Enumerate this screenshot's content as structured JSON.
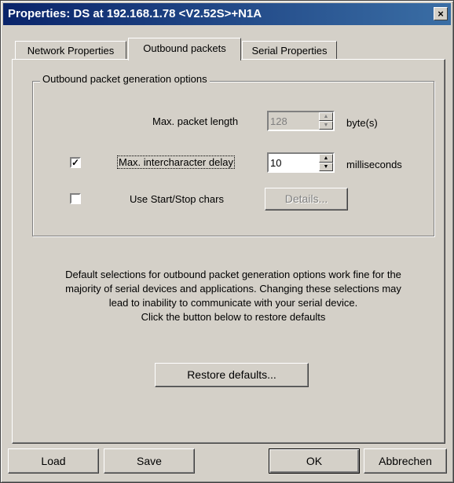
{
  "window": {
    "title": "Properties: DS at 192.168.1.78 <V2.52S>+N1A",
    "close_glyph": "×",
    "close_icon": "close-icon"
  },
  "tabs": [
    {
      "label": "Network Properties",
      "active": false
    },
    {
      "label": "Outbound packets",
      "active": true
    },
    {
      "label": "Serial Properties",
      "active": false
    }
  ],
  "group": {
    "legend": "Outbound packet generation options",
    "max_packet_length": {
      "label": "Max. packet length",
      "value": "128",
      "unit": "byte(s)",
      "enabled": false
    },
    "max_interchar_delay": {
      "checked": true,
      "check_glyph": "✓",
      "label": "Max. intercharacter delay",
      "value": "10",
      "unit": "milliseconds"
    },
    "start_stop_chars": {
      "checked": false,
      "label": "Use Start/Stop chars",
      "details_button": "Details..."
    }
  },
  "info_lines": [
    "Default selections for outbound packet generation options work fine for the",
    "majority of serial devices and applications. Changing these selections may",
    "lead to inability to communicate with your serial device.",
    "Click the button below to restore defaults"
  ],
  "restore_button": "Restore defaults...",
  "spin_up_glyph": "▲",
  "spin_down_glyph": "▼",
  "footer": {
    "load": "Load",
    "save": "Save",
    "ok": "OK",
    "cancel": "Abbrechen"
  },
  "colors": {
    "face": "#d4d0c8",
    "title_start": "#0a246a",
    "title_end": "#3a6ea5"
  }
}
